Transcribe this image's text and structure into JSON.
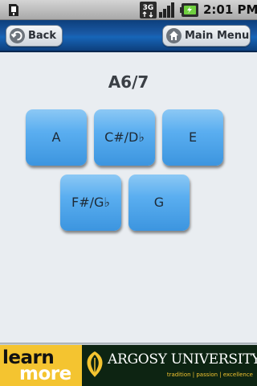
{
  "status_bar": {
    "time": "2:01 PM",
    "network_badge": "3G",
    "icons": [
      "sd-card-icon",
      "3g-data-icon",
      "signal-strength-icon",
      "battery-charging-icon"
    ]
  },
  "nav": {
    "back_label": "Back",
    "main_menu_label": "Main Menu"
  },
  "chord": {
    "title": "A6/7",
    "notes": [
      "A",
      "C#/D♭",
      "E",
      "F#/G♭",
      "G"
    ]
  },
  "ad": {
    "learn": "learn",
    "more": "more",
    "brand": "ARGOSY UNIVERSITY.",
    "tagline": "tradition | passion | excellence"
  },
  "colors": {
    "nav_bar": "#1a5aa6",
    "note_button": "#5aaef0",
    "ad_accent": "#f4c430",
    "ad_background": "#0d2412"
  }
}
